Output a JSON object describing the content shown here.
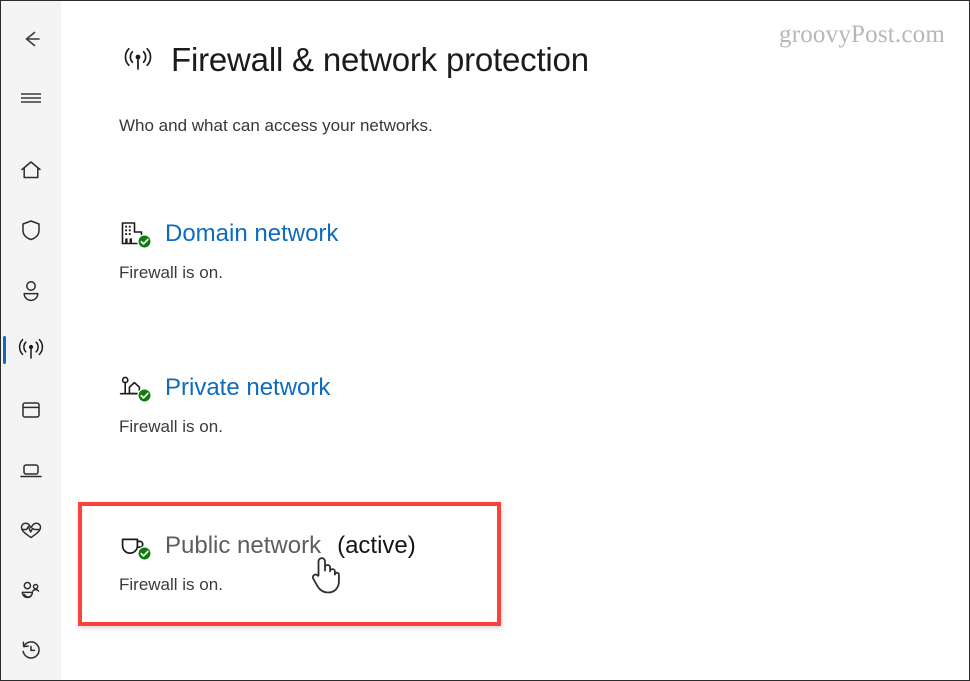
{
  "window": {
    "watermark": "groovyPost.com"
  },
  "sidebar": {
    "items": [
      {
        "name": "back-button",
        "icon": "back-arrow-icon",
        "label": "Back",
        "selected": false
      },
      {
        "name": "hamburger-button",
        "icon": "hamburger-menu-icon",
        "label": "Menu",
        "selected": false
      },
      {
        "name": "nav-home",
        "icon": "home-icon",
        "label": "Home",
        "selected": false
      },
      {
        "name": "nav-virus-threat",
        "icon": "shield-icon",
        "label": "Virus & threat protection",
        "selected": false
      },
      {
        "name": "nav-account",
        "icon": "person-icon",
        "label": "Account protection",
        "selected": false
      },
      {
        "name": "nav-firewall",
        "icon": "wifi-signal-icon",
        "label": "Firewall & network protection",
        "selected": true
      },
      {
        "name": "nav-app-browser",
        "icon": "app-window-icon",
        "label": "App & browser control",
        "selected": false
      },
      {
        "name": "nav-device-security",
        "icon": "laptop-icon",
        "label": "Device security",
        "selected": false
      },
      {
        "name": "nav-device-health",
        "icon": "heart-pulse-icon",
        "label": "Device performance & health",
        "selected": false
      },
      {
        "name": "nav-family-options",
        "icon": "people-family-icon",
        "label": "Family options",
        "selected": false
      },
      {
        "name": "nav-history",
        "icon": "history-clock-icon",
        "label": "Protection history",
        "selected": false
      }
    ]
  },
  "page": {
    "icon": "wifi-signal-icon",
    "title": "Firewall & network protection",
    "subtitle": "Who and what can access your networks."
  },
  "networks": [
    {
      "id": "domain-network",
      "icon": "building-icon",
      "badge": "green-check-badge",
      "label": "Domain network",
      "active_label": "",
      "status": "Firewall is on.",
      "hovered": false
    },
    {
      "id": "private-network",
      "icon": "house-icon",
      "badge": "green-check-badge",
      "label": "Private network",
      "active_label": "",
      "status": "Firewall is on.",
      "hovered": false
    },
    {
      "id": "public-network",
      "icon": "coffee-cup-icon",
      "badge": "green-check-badge",
      "label": "Public network",
      "active_label": "(active)",
      "status": "Firewall is on.",
      "hovered": true
    }
  ],
  "annotation": {
    "highlight_color": "#f9423a",
    "cursor": "pointing-hand-cursor"
  },
  "colors": {
    "link_blue": "#0f6cbd",
    "accent_selected": "#0f6cbd",
    "badge_green": "#107c10",
    "sidebar_bg": "#f4f4f4",
    "text_primary": "#1b1b1b",
    "text_secondary": "#3b3b3b",
    "hover_gray": "#5d5d5d"
  }
}
